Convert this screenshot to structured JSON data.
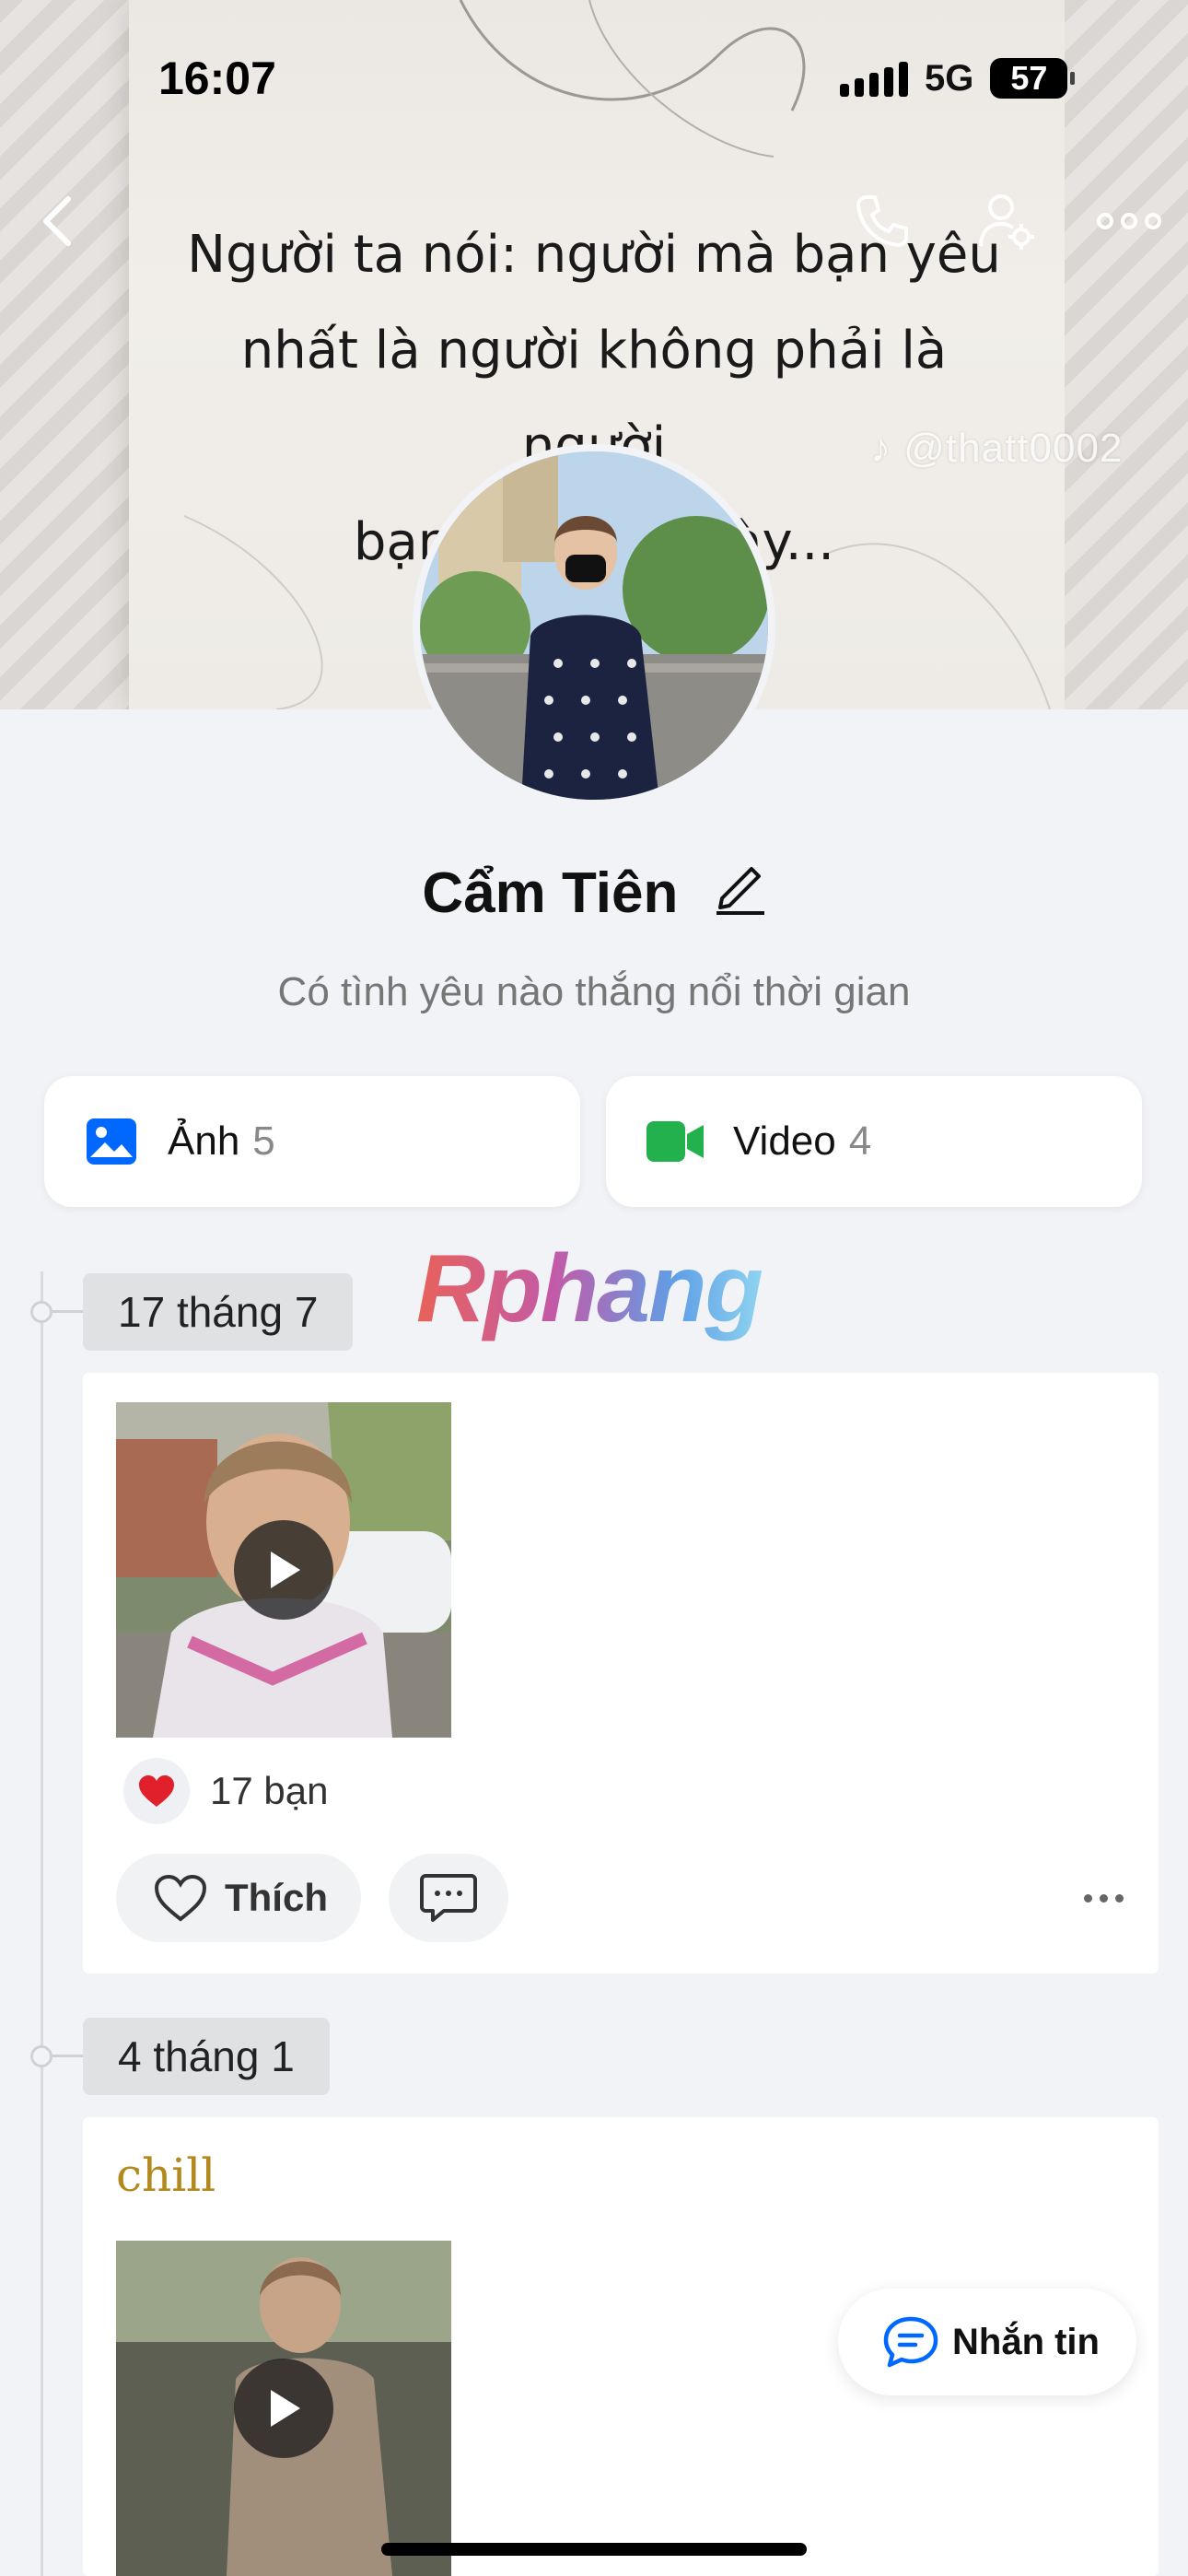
{
  "status_bar": {
    "time": "16:07",
    "network": "5G",
    "battery": "57"
  },
  "cover": {
    "quote_lines": [
      "Người ta nói: người mà bạn yêu",
      "nhất là người không phải là người",
      "bạn cưới sau này..."
    ],
    "watermark": "@thatt0002"
  },
  "profile": {
    "name": "Cẩm Tiên",
    "bio": "Có tình yêu nào thắng nổi thời gian"
  },
  "media": {
    "photos_label": "Ảnh",
    "photos_count": "5",
    "videos_label": "Video",
    "videos_count": "4"
  },
  "overlay_watermark": "Rphang",
  "timeline": [
    {
      "date": "17 tháng 7",
      "reaction_count": "17 bạn",
      "like_label": "Thích"
    },
    {
      "date": "4 tháng 1",
      "caption": "chill"
    }
  ],
  "message_button": {
    "label": "Nhắn tin"
  },
  "colors": {
    "accent": "#0068ff",
    "video_green": "#22b14c",
    "caption_gold": "#b3891e",
    "heart_red": "#e0202b"
  }
}
